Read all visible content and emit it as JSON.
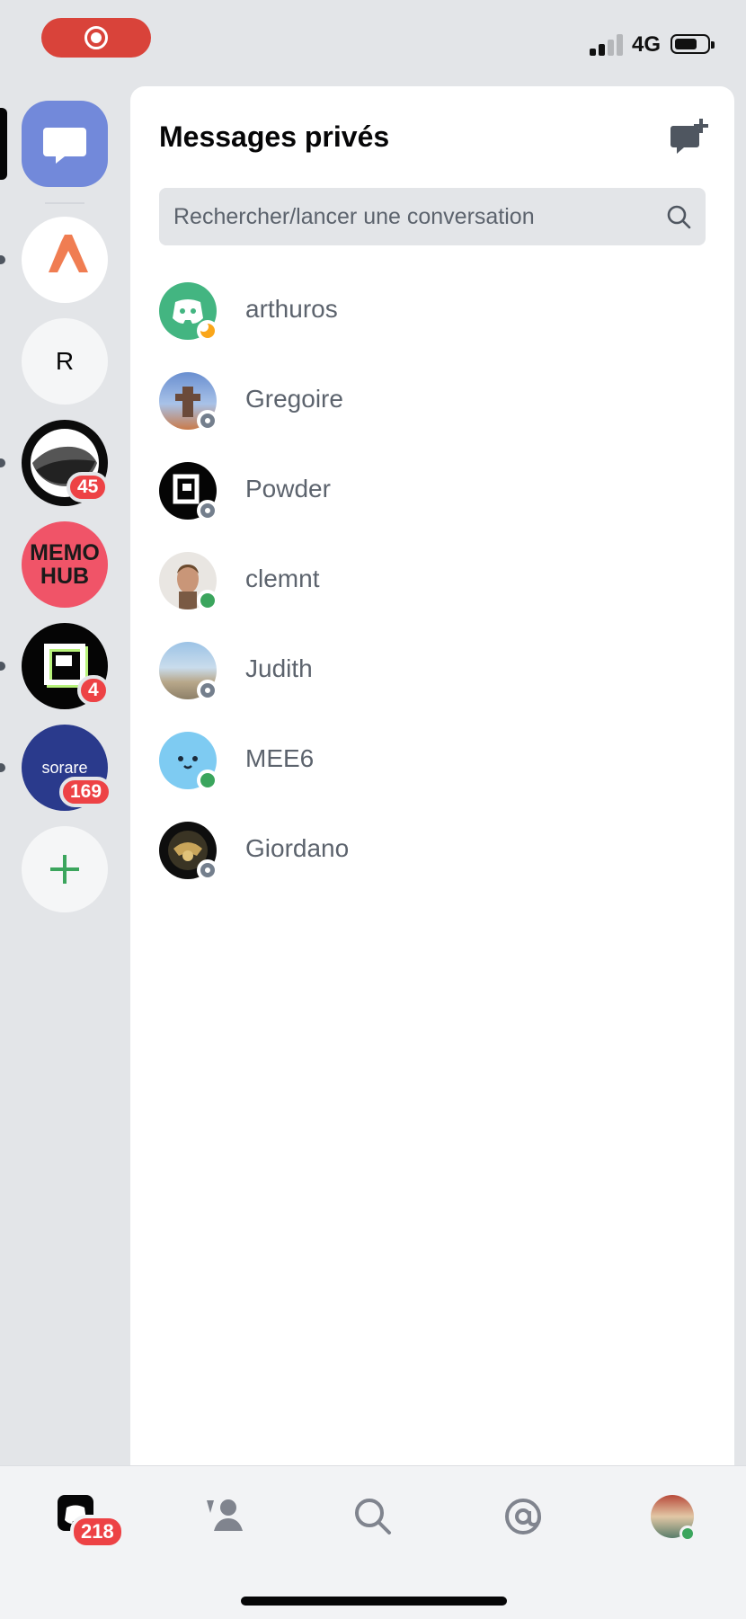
{
  "status_bar": {
    "network": "4G"
  },
  "rail": {
    "servers": [
      {
        "name": "direct-messages",
        "badge": ""
      },
      {
        "name": "server-orange",
        "badge": ""
      },
      {
        "name": "server-r",
        "initial": "R",
        "badge": ""
      },
      {
        "name": "server-swirl",
        "badge": "45"
      },
      {
        "name": "server-memohub",
        "line1": "MEMO",
        "line2": "HUB",
        "badge": ""
      },
      {
        "name": "server-p",
        "badge": "4"
      },
      {
        "name": "server-sorare",
        "label": "sorare",
        "badge": "169"
      }
    ],
    "add_label": "+"
  },
  "panel": {
    "title": "Messages privés",
    "search_placeholder": "Rechercher/lancer une conversation"
  },
  "dms": [
    {
      "name": "arthuros",
      "status": "idle"
    },
    {
      "name": "Gregoire",
      "status": "offline"
    },
    {
      "name": "Powder",
      "status": "offline"
    },
    {
      "name": "clemnt",
      "status": "online"
    },
    {
      "name": "Judith",
      "status": "offline"
    },
    {
      "name": "MEE6",
      "status": "online"
    },
    {
      "name": "Giordano",
      "status": "offline"
    }
  ],
  "tabbar": {
    "home_badge": "218"
  },
  "colors": {
    "blurple": "#7289da",
    "badge_red": "#ed4245",
    "online": "#3ba55d",
    "idle": "#faa61a",
    "offline": "#747f8d"
  }
}
